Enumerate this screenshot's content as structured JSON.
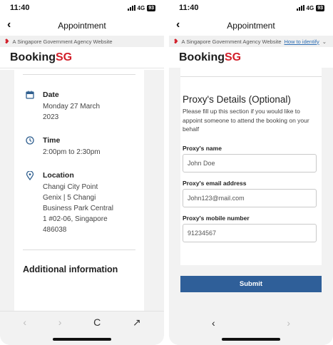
{
  "left": {
    "status": {
      "time": "11:40",
      "network": "4G",
      "battery": "93"
    },
    "title": "Appointment",
    "gov_banner": "A Singapore Government Agency Website",
    "logo": {
      "prefix": "Booking",
      "suffix": "SG"
    },
    "date": {
      "label": "Date",
      "lines": [
        "Monday 27 March",
        "2023"
      ]
    },
    "time": {
      "label": "Time",
      "lines": [
        "2:00pm to 2:30pm"
      ]
    },
    "location": {
      "label": "Location",
      "lines": [
        "Changi City Point",
        "Genix | 5 Changi",
        "Business Park Central",
        "1 #02-06, Singapore",
        "486038"
      ]
    },
    "additional_info": "Additional information",
    "browser": {
      "back": "‹",
      "forward": "›",
      "reload": "C",
      "share": "↗"
    }
  },
  "right": {
    "status": {
      "time": "11:40",
      "network": "4G",
      "battery": "93"
    },
    "title": "Appointment",
    "gov_banner": "A Singapore Government Agency Website",
    "gov_link": "How to identify",
    "logo": {
      "prefix": "Booking",
      "suffix": "SG"
    },
    "proxy": {
      "title": "Proxy's Details (Optional)",
      "description": "Please fill up this section if you would like to appoint someone to attend the booking on your behalf",
      "name_label": "Proxy's name",
      "name_value": "John Doe",
      "email_label": "Proxy's email address",
      "email_value": "John123@mail.com",
      "mobile_label": "Proxy's mobile number",
      "mobile_value": "91234567"
    },
    "submit": "Submit",
    "nav": {
      "back": "‹",
      "forward": "›"
    }
  },
  "colors": {
    "brand_red": "#d21f2a",
    "accent_blue": "#2f5f99"
  }
}
